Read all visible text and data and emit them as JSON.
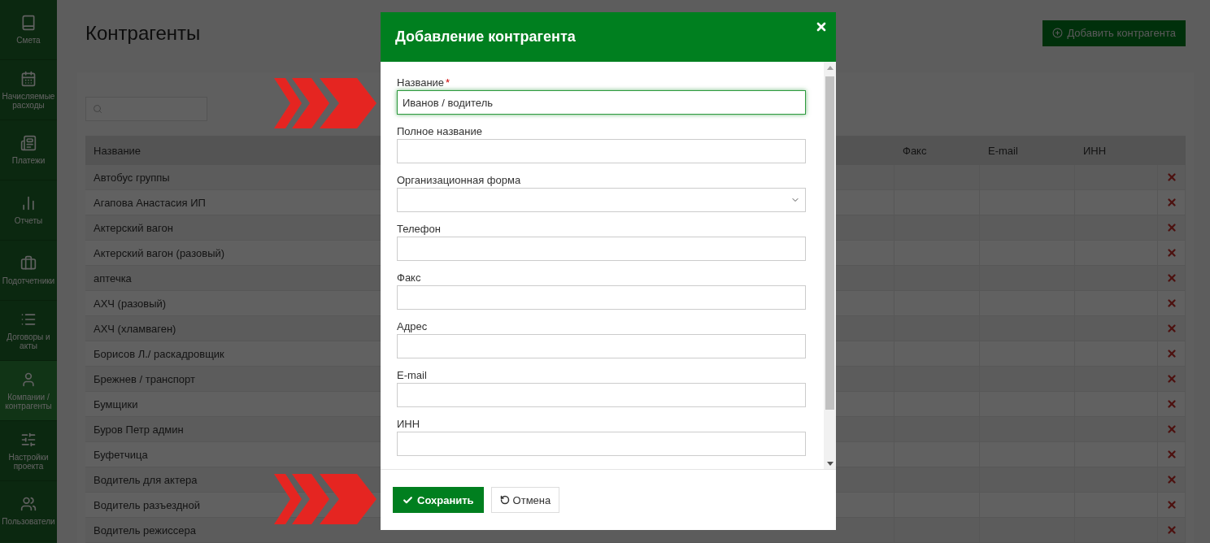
{
  "sidebar": {
    "items": [
      {
        "label": "Смета",
        "selected": false
      },
      {
        "label": "Начисляемые расходы",
        "selected": false
      },
      {
        "label": "Платежи",
        "selected": false
      },
      {
        "label": "Отчеты",
        "selected": false
      },
      {
        "label": "Подотчетники",
        "selected": false
      },
      {
        "label": "Договоры и акты",
        "selected": false
      },
      {
        "label": "Компании / контрагенты",
        "selected": true
      },
      {
        "label": "Настройки проекта",
        "selected": false
      },
      {
        "label": "Пользователи",
        "selected": false
      }
    ]
  },
  "page": {
    "title": "Контрагенты",
    "add_button": "Добавить контрагента"
  },
  "table": {
    "columns": [
      "Название",
      "Факс",
      "E-mail",
      "ИНН"
    ],
    "rows": [
      "Автобус группы",
      "Агапова Анастасия ИП",
      "Актерский вагон",
      "Актерский вагон (разовый)",
      "аптечка",
      "АХЧ (разовый)",
      "АХЧ (хламваген)",
      "Борисов Л./ раскадровщик",
      "Брежнев / транспорт",
      "Бумщики",
      "Буров Петр админ",
      "Буфетчица",
      "Водитель для актера",
      "Водитель разъездной",
      "Водитель режиссера"
    ]
  },
  "dialog": {
    "title": "Добавление контрагента",
    "fields": [
      {
        "label": "Название",
        "kind": "text",
        "required_mark": "*",
        "focused": true,
        "value": "Иванов / водитель"
      },
      {
        "label": "Полное название",
        "kind": "text",
        "focused": false
      },
      {
        "label": "Организационная форма",
        "kind": "select",
        "focused": false
      },
      {
        "label": "Телефон",
        "kind": "text",
        "focused": false
      },
      {
        "label": "Факс",
        "kind": "text",
        "focused": false
      },
      {
        "label": "Адрес",
        "kind": "text",
        "focused": false
      },
      {
        "label": "E-mail",
        "kind": "text",
        "focused": false
      },
      {
        "label": "ИНН",
        "kind": "text",
        "focused": false
      }
    ],
    "save_button": "Сохранить",
    "cancel_button": "Отмена"
  }
}
